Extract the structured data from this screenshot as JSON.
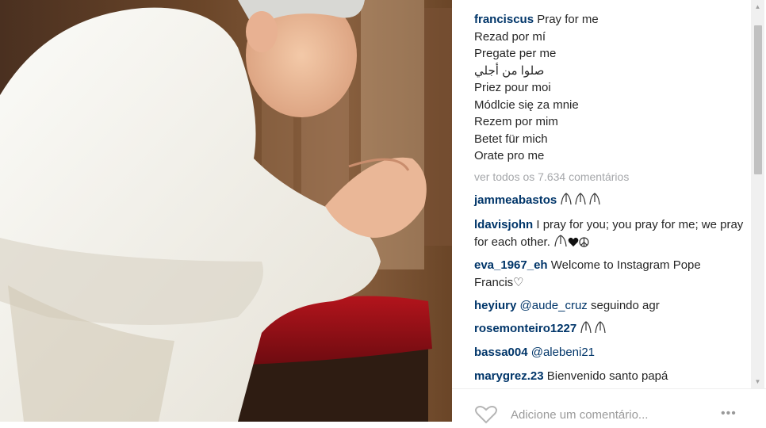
{
  "post": {
    "author": "franciscus",
    "caption_lines": [
      "Pray for me",
      "Rezad por mí",
      "Pregate per me",
      "صلوا من أجلي",
      "Priez pour moi",
      "Módlcie się za mnie",
      "Rezem por mim",
      "Betet für mich",
      "Orate pro me"
    ],
    "view_all": "ver todos os 7.634 comentários"
  },
  "comments": [
    {
      "user": "jammeabastos",
      "text": ""
    },
    {
      "user": "ldavisjohn",
      "text": " I pray for you; you pray for me; we pray for each other."
    },
    {
      "user": "eva_1967_eh",
      "text": " Welcome to Instagram Pope Francis♡"
    },
    {
      "user": "heyiury",
      "mention": "@aude_cruz",
      "text": " seguindo agr"
    },
    {
      "user": "rosemonteiro1227",
      "text": ""
    },
    {
      "user": "bassa004",
      "mention": "@alebeni21",
      "text": ""
    },
    {
      "user": "marygrez.23",
      "text": " Bienvenido santo papá"
    }
  ],
  "footer": {
    "add_comment_placeholder": "Adicione um comentário...",
    "more_label": "•••"
  },
  "colors": {
    "username": "#003569",
    "text": "#262626",
    "muted": "#a5a7aa",
    "scrollbar_track": "#f0f0f0",
    "scrollbar_thumb": "#c1c1c1"
  },
  "icons": [
    "heart-icon",
    "more-options-icon",
    "praying-hands-emoji",
    "peace-icon"
  ]
}
